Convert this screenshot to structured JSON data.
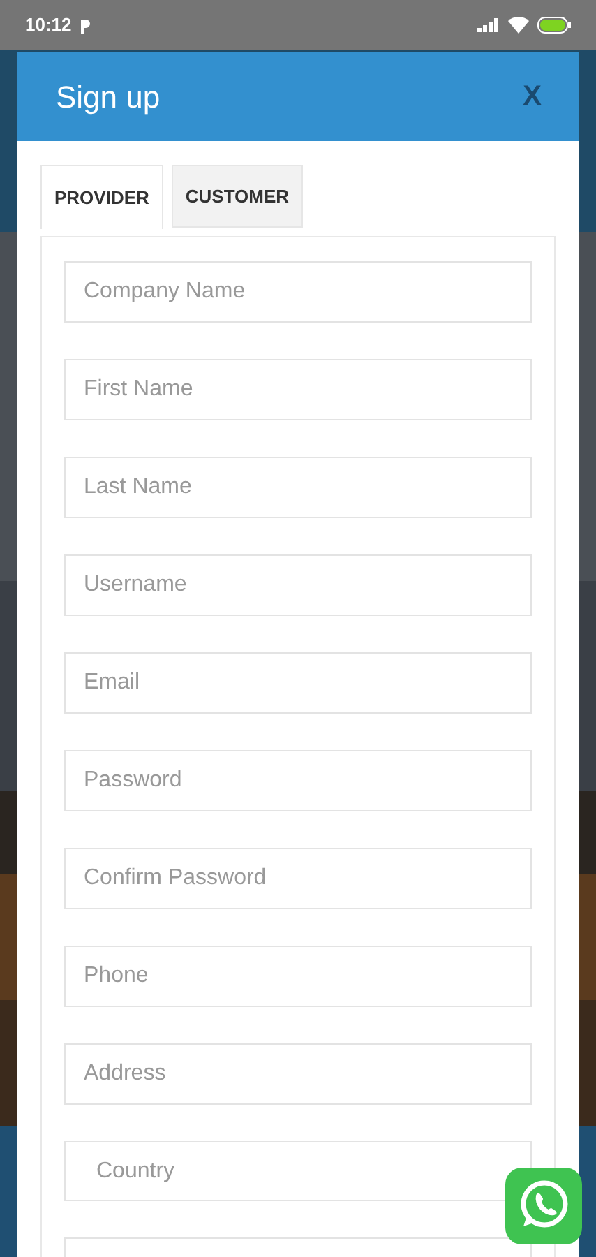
{
  "status_bar": {
    "time": "10:12"
  },
  "dialog": {
    "title": "Sign up",
    "close": "X"
  },
  "tabs": [
    {
      "label": "PROVIDER",
      "selected": true
    },
    {
      "label": "CUSTOMER",
      "selected": false
    }
  ],
  "fields": [
    {
      "kind": "text",
      "placeholder": "Company Name"
    },
    {
      "kind": "text",
      "placeholder": "First Name"
    },
    {
      "kind": "text",
      "placeholder": "Last Name"
    },
    {
      "kind": "text",
      "placeholder": "Username"
    },
    {
      "kind": "text",
      "placeholder": "Email"
    },
    {
      "kind": "text",
      "placeholder": "Password"
    },
    {
      "kind": "text",
      "placeholder": "Confirm Password"
    },
    {
      "kind": "text",
      "placeholder": "Phone"
    },
    {
      "kind": "text",
      "placeholder": "Address"
    },
    {
      "kind": "select",
      "placeholder": "Country"
    },
    {
      "kind": "text"
    }
  ]
}
